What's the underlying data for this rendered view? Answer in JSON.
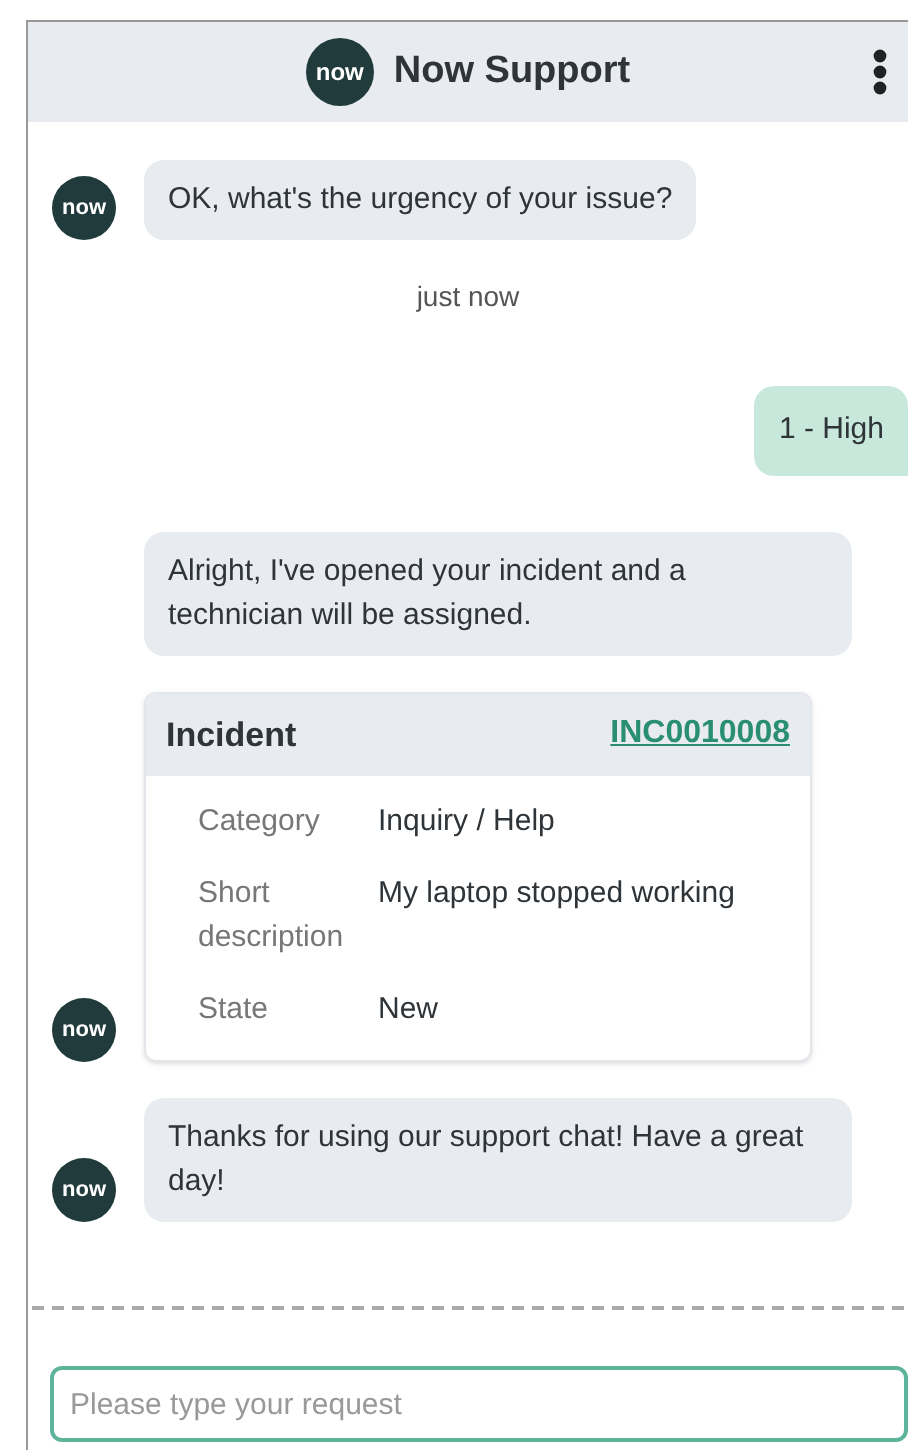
{
  "header": {
    "logo": "now",
    "title": "Now Support"
  },
  "messages": [
    {
      "kind": "bot",
      "avatar": "now",
      "text": "OK, what's the urgency of your issue?"
    },
    {
      "kind": "timestamp",
      "text": "just now"
    },
    {
      "kind": "user",
      "text": "1 - High"
    },
    {
      "kind": "bot",
      "text": "Alright, I've opened your incident and a technician will be assigned."
    },
    {
      "kind": "card",
      "avatar": "now",
      "title": "Incident",
      "link": "INC0010008",
      "fields": [
        {
          "label": "Category",
          "value": "Inquiry / Help"
        },
        {
          "label": "Short description",
          "value": "My laptop stopped working"
        },
        {
          "label": "State",
          "value": "New"
        }
      ]
    },
    {
      "kind": "bot",
      "avatar": "now",
      "text": "Thanks for using our support chat! Have a great day!"
    }
  ],
  "input": {
    "placeholder": "Please type your request"
  }
}
